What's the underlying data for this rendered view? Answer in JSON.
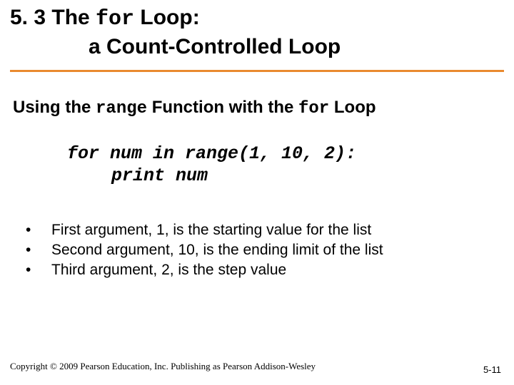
{
  "title": {
    "line1_pre": "5. 3 The ",
    "line1_code": "for",
    "line1_post": " Loop:",
    "line2": "a Count-Controlled Loop"
  },
  "subtitle": {
    "pre": "Using the ",
    "code1": "range",
    "mid": " Function with the ",
    "code2": "for",
    "post": " Loop"
  },
  "code": {
    "line1": "for num in range(1, 10, 2):",
    "line2": "print num"
  },
  "bullets": [
    "First argument, 1, is the starting value for the list",
    "Second argument, 10, is the ending limit of the list",
    "Third argument, 2, is the step value"
  ],
  "footer": {
    "copyright": "Copyright © 2009 Pearson Education, Inc. Publishing as Pearson Addison-Wesley",
    "pagenum": "5-11"
  }
}
